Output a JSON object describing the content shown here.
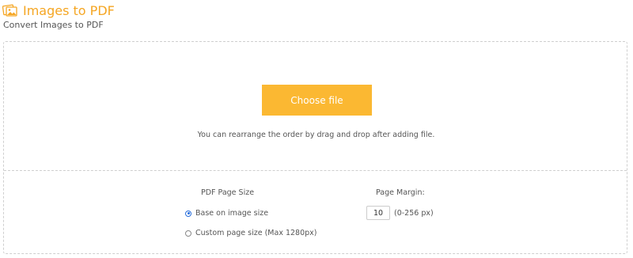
{
  "header": {
    "title": "Images to PDF",
    "subtitle": "Convert Images to PDF",
    "icon": "images-icon",
    "accent_color": "#f5a623"
  },
  "upload": {
    "choose_button_label": "Choose file",
    "button_color": "#fbb832",
    "hint": "You can rearrange the order by drag and drop after adding file."
  },
  "options": {
    "page_size_label": "PDF Page Size",
    "page_size_options": [
      {
        "label": "Base on image size",
        "selected": true
      },
      {
        "label": "Custom page size (Max 1280px)",
        "selected": false
      }
    ],
    "margin_label": "Page Margin:",
    "margin_value": "10",
    "margin_range": "(0-256 px)"
  }
}
